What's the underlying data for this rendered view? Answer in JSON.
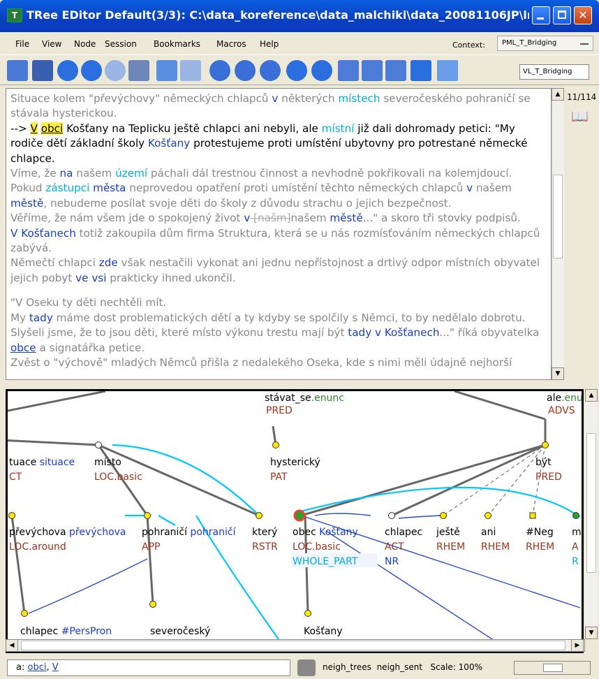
{
  "title": "TRee EDitor   Default(3/3): C:\\data_koreference\\data_malchiki\\data_20081106JP\\ln...",
  "menu": [
    "File",
    "View",
    "Node",
    "Session",
    "Bookmarks",
    "Macros",
    "Help"
  ],
  "context": {
    "label": "Context:",
    "value": "PML_T_Bridging"
  },
  "layer": "VL_T_Bridging",
  "page_counter": "11/114",
  "text": {
    "p1a": "Situace kolem \"převýchovy\" německých chlapců ",
    "p1v": "v",
    "p1b": " některých ",
    "p1c": "místech",
    "p1d": " severočeského pohraničí se stávala hysterickou.",
    "p2arrow": "--> ",
    "p2v": "V",
    "p2obci": "obci",
    "p2a": " Košťany na Teplicku ještě chlapci ani nebyli, ale ",
    "p2m": "místní",
    "p2b": " již dali dohromady petici: \"My rodiče dětí základní školy ",
    "p2k": "Košťany",
    "p2c": " protestujeme proti umístění ubytovny pro potrestané německé chlapce.",
    "p3a": "Víme, že ",
    "p3na": "na",
    "p3b": " našem ",
    "p3u": "území",
    "p3c": " páchali dál trestnou činnost a nevhodně pokřikovali na kolemjdoucí.",
    "p4a": "Pokud ",
    "p4z": "zástupci",
    "p4b": " ",
    "p4m": "města",
    "p4c": " neprovedou opatření proti umístění těchto německých chlapců ",
    "p4v": "v",
    "p4d": " našem ",
    "p4me": "městě",
    "p4e": ", nebudeme posílat svoje děti do školy z důvodu strachu o jejich bezpečnost.",
    "p5a": "Věříme, že nám všem jde o spokojený život ",
    "p5v": "v",
    "p5s": " [našm]",
    "p5b": "našem ",
    "p5m": "městě",
    "p5c": "...\" a skoro tři stovky podpisů.",
    "p6v": "V Košťanech",
    "p6a": " totiž zakoupila dům firma Struktura, která se u nás rozmísťováním německých chlapců zabývá.",
    "p7a": "Němečtí chlapci ",
    "p7z": "zde",
    "p7b": " však nestačili vykonat ani jednu nepřístojnost a drtivý odpor místních obyvatel jejich pobyt ",
    "p7v": "ve vsi",
    "p7c": " prakticky ihned ukončil.",
    "p8": "\"V Oseku ty děti nechtěli mít.",
    "p9a": "My ",
    "p9t": "tady",
    "p9b": " máme dost problematických dětí a ty kdyby se spolčily s Němci, to by nedělalo dobrotu.",
    "p10a": "Slyšeli jsme, že to jsou děti, které místo výkonu trestu mají být ",
    "p10t": "tady v Košťanech",
    "p10b": "...\" říká obyvatelka ",
    "p10o": "obce",
    "p10c": " a signatářka petice.",
    "p11": "Zvěst o \"výchově\" mladých Němců přišla z nedalekého Oseka, kde s nimi měli údajně nejhorší"
  },
  "tree": {
    "top_label": "stávat_se",
    "top_suffix": ".enunc",
    "top_func": "PRED",
    "ale_label": "ale",
    "ale_suffix": ".enu",
    "ale_func": "ADVS",
    "nodes": [
      {
        "lemma": "tuace",
        "extra": "situace",
        "func": "CT"
      },
      {
        "lemma": "místo",
        "extra": "",
        "func": "LOC.basic"
      },
      {
        "lemma": "hysterický",
        "extra": "",
        "func": "PAT"
      },
      {
        "lemma": "být",
        "extra": "",
        "func": "PRED"
      },
      {
        "lemma": "převýchova",
        "extra": "převýchova",
        "func": "LOC.around"
      },
      {
        "lemma": "pohraničí",
        "extra": "pohraničí",
        "func": "APP"
      },
      {
        "lemma": "který",
        "extra": "",
        "func": "RSTR"
      },
      {
        "lemma": "obec",
        "extra": "Košťany",
        "func": "LOC.basic"
      },
      {
        "lemma": "chlapec",
        "extra": "",
        "func": "ACT"
      },
      {
        "lemma": "ještě",
        "extra": "",
        "func": "RHEM"
      },
      {
        "lemma": "ani",
        "extra": "",
        "func": "RHEM"
      },
      {
        "lemma": "#Neg",
        "extra": "",
        "func": "RHEM"
      },
      {
        "lemma": "m",
        "extra": "",
        "func": "A"
      },
      {
        "lemma": "chlapec",
        "extra": "#PersPron",
        "func": ""
      },
      {
        "lemma": "severočeský",
        "extra": "",
        "func": ""
      },
      {
        "lemma": "Košťany",
        "extra": "",
        "func": ""
      }
    ],
    "coref1": "WHOLE_PART",
    "coref2": "NR",
    "coref3": "R"
  },
  "status": {
    "prefix": "a: ",
    "link1": "obci",
    "sep": ", ",
    "link2": "V",
    "neigh_trees": "neigh_trees",
    "neigh_sent": "neigh_sent",
    "scale": "Scale: 100%"
  },
  "colors": {
    "titlebar": "#0a4fd0",
    "highlight": "#ffef3a",
    "coref_cyan": "#00c8ff",
    "coref_blue": "#2b4cc4",
    "func_red": "#a0341c",
    "node_yellow": "#ffe800"
  }
}
